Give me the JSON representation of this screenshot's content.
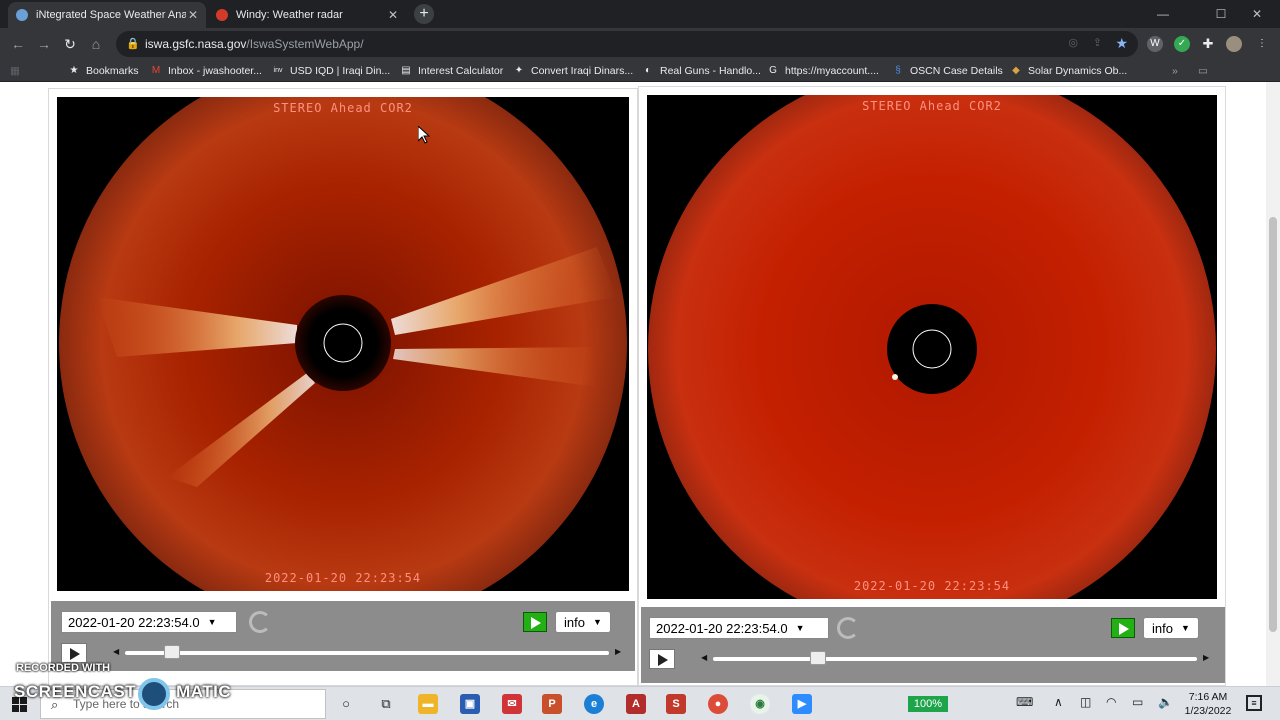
{
  "browser": {
    "tabs": [
      {
        "label": "iNtegrated Space Weather Analy",
        "active": true
      },
      {
        "label": "Windy: Weather radar",
        "active": false
      }
    ],
    "new_tab": "+",
    "url_host": "iswa.gsfc.nasa.gov",
    "url_path": "/IswaSystemWebApp/",
    "window_controls": [
      "—",
      "☐",
      "✕"
    ],
    "bookmarks": [
      {
        "label": "Bookmarks",
        "icon": "star-icon"
      },
      {
        "label": "Inbox - jwashooter...",
        "icon": "gmail-icon"
      },
      {
        "label": "USD IQD | Iraqi Din...",
        "icon": "inv-icon"
      },
      {
        "label": "Interest Calculator",
        "icon": "calculator-icon"
      },
      {
        "label": "Convert Iraqi Dinars...",
        "icon": "currency-icon"
      },
      {
        "label": "Real Guns - Handlo...",
        "icon": "globe-icon"
      },
      {
        "label": "https://myaccount....",
        "icon": "google-icon"
      },
      {
        "label": "OSCN Case Details",
        "icon": "oscn-icon"
      },
      {
        "label": "Solar Dynamics Ob...",
        "icon": "sdo-icon"
      }
    ]
  },
  "panels": [
    {
      "instrument_label": "STEREO Ahead COR2",
      "timestamp_label": "2022-01-20 22:23:54",
      "date_select": "2022-01-20 22:23:54.0",
      "info_label": "info",
      "slider_position_pct": 8
    },
    {
      "instrument_label": "STEREO Ahead COR2",
      "timestamp_label": "2022-01-20 22:23:54",
      "date_select": "2022-01-20 22:23:54.0",
      "info_label": "info",
      "slider_position_pct": 20
    }
  ],
  "watermark": {
    "line1": "RECORDED WITH",
    "line2_left": "SCREENCAST",
    "line2_right": "MATIC"
  },
  "taskbar": {
    "search_placeholder": "Type here to search",
    "battery": "100%",
    "time": "7:16 AM",
    "date": "1/23/2022"
  },
  "colors": {
    "corona_red": "#c01800",
    "occulter": "#000000",
    "controls_gray": "#8c8c8c",
    "movie_green": "#22b014"
  }
}
